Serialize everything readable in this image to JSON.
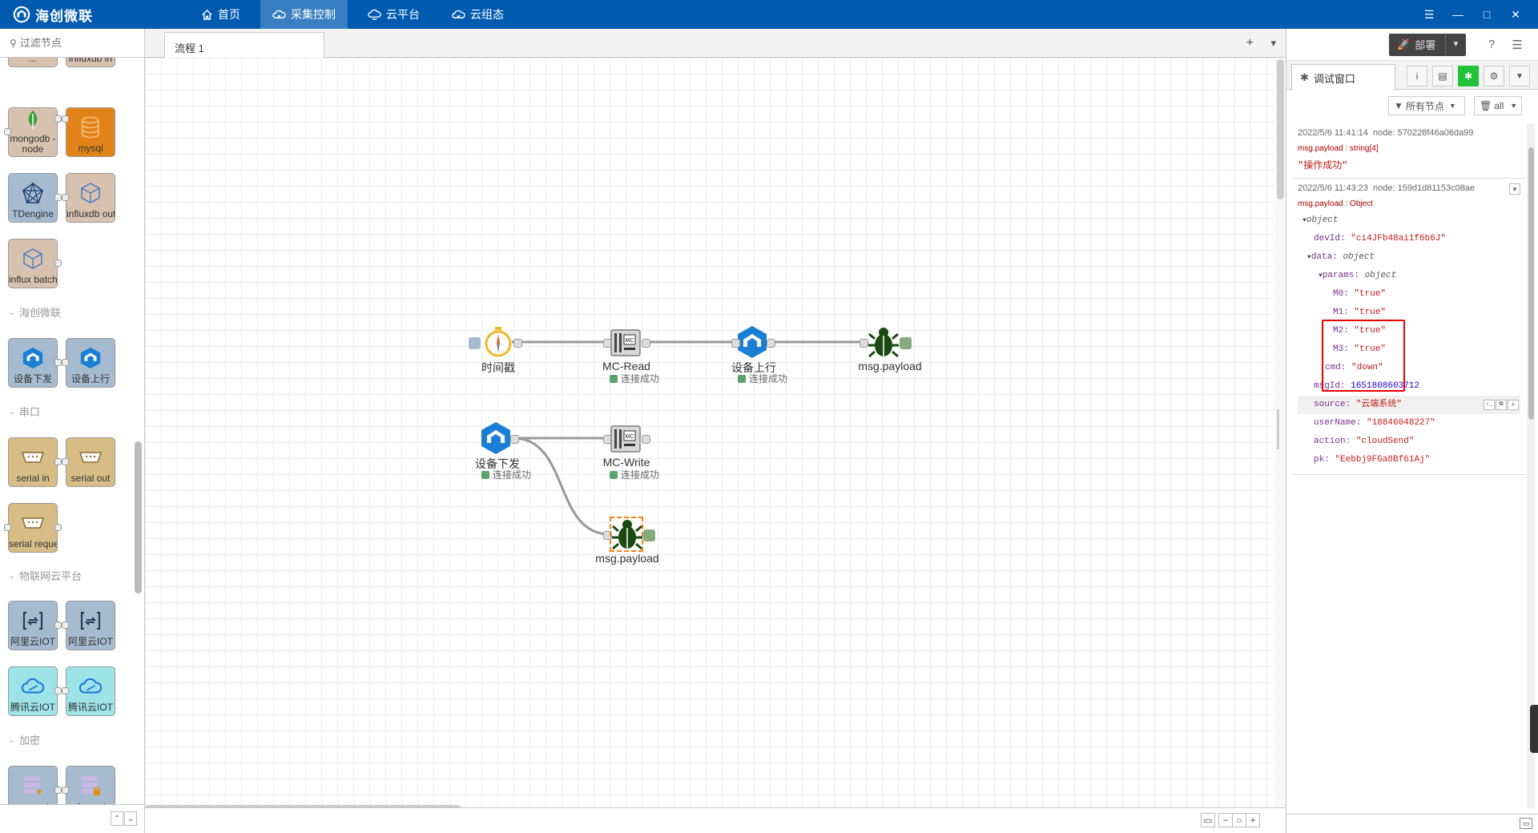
{
  "app": {
    "name": "海创微联"
  },
  "nav": [
    {
      "label": "首页",
      "icon": "home-icon",
      "active": false
    },
    {
      "label": "采集控制",
      "icon": "cloud-settings-icon",
      "active": true
    },
    {
      "label": "云平台",
      "icon": "cloud-platform-icon",
      "active": false
    },
    {
      "label": "云组态",
      "icon": "cloud-config-icon",
      "active": false
    }
  ],
  "window_controls": [
    "☰",
    "—",
    "□",
    "✕"
  ],
  "palette": {
    "filter_placeholder": "过滤节点",
    "truncated_top": [
      "...",
      "influxdb in"
    ],
    "categories": [
      {
        "label": "海创微联"
      },
      {
        "label": "串口"
      },
      {
        "label": "物联网云平台"
      },
      {
        "label": "加密"
      }
    ],
    "nodes": [
      {
        "label": "mongodb - node",
        "color": "#d7c2b0"
      },
      {
        "label": "mysql",
        "color": "#e2831a"
      },
      {
        "label": "TDengine",
        "color": "#a6bbcf"
      },
      {
        "label": "influxdb out",
        "color": "#d7c2b0"
      },
      {
        "label": "influx batch",
        "color": "#d7c2b0"
      },
      {
        "label": "设备下发",
        "color": "#a6bbcf"
      },
      {
        "label": "设备上行",
        "color": "#a6bbcf"
      },
      {
        "label": "serial in",
        "color": "#d8bc86"
      },
      {
        "label": "serial out",
        "color": "#d8bc86"
      },
      {
        "label": "serial reque",
        "color": "#d8bc86"
      },
      {
        "label": "阿里云IOT",
        "color": "#a6bbcf"
      },
      {
        "label": "阿里云IOT",
        "color": "#a6bbcf"
      },
      {
        "label": "腾讯云IOT",
        "color": "#9ee3e8"
      },
      {
        "label": "腾讯云IOT",
        "color": "#9ee3e8"
      },
      {
        "label": "encrypt",
        "color": "#a6bbcf"
      },
      {
        "label": "decrypt",
        "color": "#a6bbcf"
      }
    ]
  },
  "workspace": {
    "tab": "流程 1",
    "add": "+",
    "menu": "▾",
    "zoom_buttons": [
      "▭",
      "−",
      "○",
      "+"
    ]
  },
  "flow": {
    "nodes": [
      {
        "id": "inject",
        "label": "时间戳",
        "status": ""
      },
      {
        "id": "mcread",
        "label": "MC-Read",
        "status": "连接成功"
      },
      {
        "id": "up",
        "label": "设备上行",
        "status": "连接成功"
      },
      {
        "id": "debug1",
        "label": "msg.payload",
        "status": ""
      },
      {
        "id": "down",
        "label": "设备下发",
        "status": "连接成功"
      },
      {
        "id": "mcwrite",
        "label": "MC-Write",
        "status": "连接成功"
      },
      {
        "id": "debug2",
        "label": "msg.payload",
        "status": ""
      }
    ]
  },
  "sidebar": {
    "deploy": "部署",
    "tab": "调试窗口",
    "filter_nodes": "所有节点",
    "clear_all": "all",
    "messages": [
      {
        "time": "2022/5/6 11:41:14",
        "node": "node: 570228f46a06da99",
        "topic": "msg.payload : string[4]",
        "value": "\"操作成功\""
      },
      {
        "time": "2022/5/6 11:43:23",
        "node": "node: 159d1d81153c08ae",
        "topic": "msg.payload : Object",
        "tree": {
          "root": "object",
          "devId_key": "devId:",
          "devId": "\"ci4JFb48ai1f6b6J\"",
          "data_key": "data:",
          "data_type": "object",
          "params_key": "params:",
          "params_type": "object",
          "m0_key": "M0:",
          "m0": "\"true\"",
          "m1_key": "M1:",
          "m1": "\"true\"",
          "m2_key": "M2:",
          "m2": "\"true\"",
          "m3_key": "M3:",
          "m3": "\"true\"",
          "cmd_key": "cmd:",
          "cmd": "\"down\"",
          "msgId_key": "msgId:",
          "msgId": "1651808603712",
          "source_key": "source:",
          "source": "\"云端系统\"",
          "userName_key": "userName:",
          "userName": "\"18846048227\"",
          "action_key": "action:",
          "action": "\"cloudSend\"",
          "pk_key": "pk:",
          "pk": "\"Eebbj9FGa8Bf61Aj\""
        }
      }
    ]
  }
}
